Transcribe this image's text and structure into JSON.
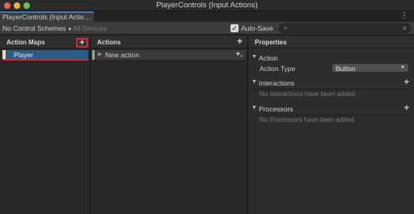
{
  "window": {
    "title": "PlayerControls (Input Actions)"
  },
  "tab": {
    "label": "PlayerControls (Input Actio…"
  },
  "toolbar": {
    "control_schemes": "No Control Schemes",
    "devices": "All Devices",
    "autosave_label": "Auto-Save",
    "autosave_checked": true,
    "search_value": ""
  },
  "action_maps": {
    "title": "Action Maps",
    "items": [
      {
        "label": "Player",
        "selected": true
      }
    ]
  },
  "actions": {
    "title": "Actions",
    "items": [
      {
        "label": "New action"
      }
    ]
  },
  "properties": {
    "title": "Properties",
    "action_section": "Action",
    "action_type_label": "Action Type",
    "action_type_value": "Button",
    "interactions_section": "Interactions",
    "interactions_empty": "No Interactions have been added.",
    "processors_section": "Processors",
    "processors_empty": "No Processors have been added."
  },
  "colors": {
    "selected_row": "#2c5d87",
    "highlight_box": "#d8262c",
    "tab_accent": "#3a79bb"
  }
}
